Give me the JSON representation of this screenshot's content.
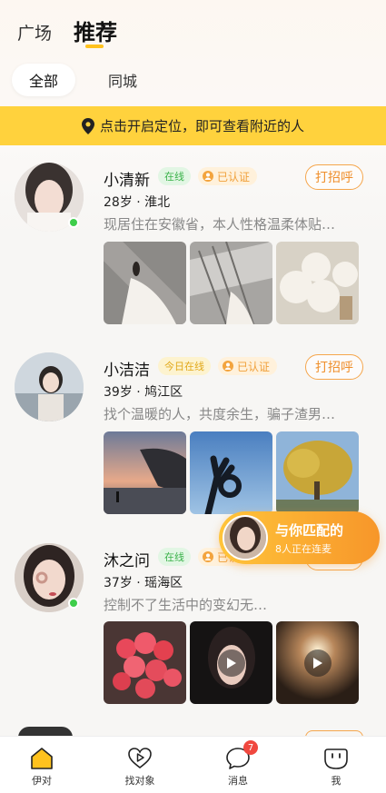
{
  "top_tabs": {
    "plaza": "广场",
    "recommend": "推荐"
  },
  "filters": {
    "all": "全部",
    "city": "同城"
  },
  "location_banner": {
    "text": "点击开启定位，即可查看附近的人"
  },
  "greet_label": "打招呼",
  "verified_label": "已认证",
  "cards": [
    {
      "name": "小清新",
      "status": "在线",
      "meta": "28岁 · 淮北",
      "bio": "现居住在安徽省，本人性格温柔体贴…",
      "online": true
    },
    {
      "name": "小洁洁",
      "status": "今日在线",
      "meta": "39岁 · 鸠江区",
      "bio": "找个温暖的人，共度余生，骗子渣男…",
      "online": false
    },
    {
      "name": "沐之问",
      "status": "在线",
      "meta": "37岁 · 瑶海区",
      "bio": "控制不了生活中的变幻无…",
      "online": true
    }
  ],
  "match_pill": {
    "title": "与你匹配的",
    "subtitle": "8人正在连麦"
  },
  "bottom_nav": {
    "items": [
      {
        "label": "伊对",
        "icon": "home-icon"
      },
      {
        "label": "找对象",
        "icon": "heart-play-icon"
      },
      {
        "label": "消息",
        "icon": "chat-bubble-icon"
      },
      {
        "label": "我",
        "icon": "face-icon"
      }
    ],
    "message_badge": "7"
  },
  "colors": {
    "accent_yellow": "#ffd23d",
    "greet_orange": "#ef8f2c",
    "online_green": "#3fce4b",
    "badge_red": "#f0483f"
  }
}
